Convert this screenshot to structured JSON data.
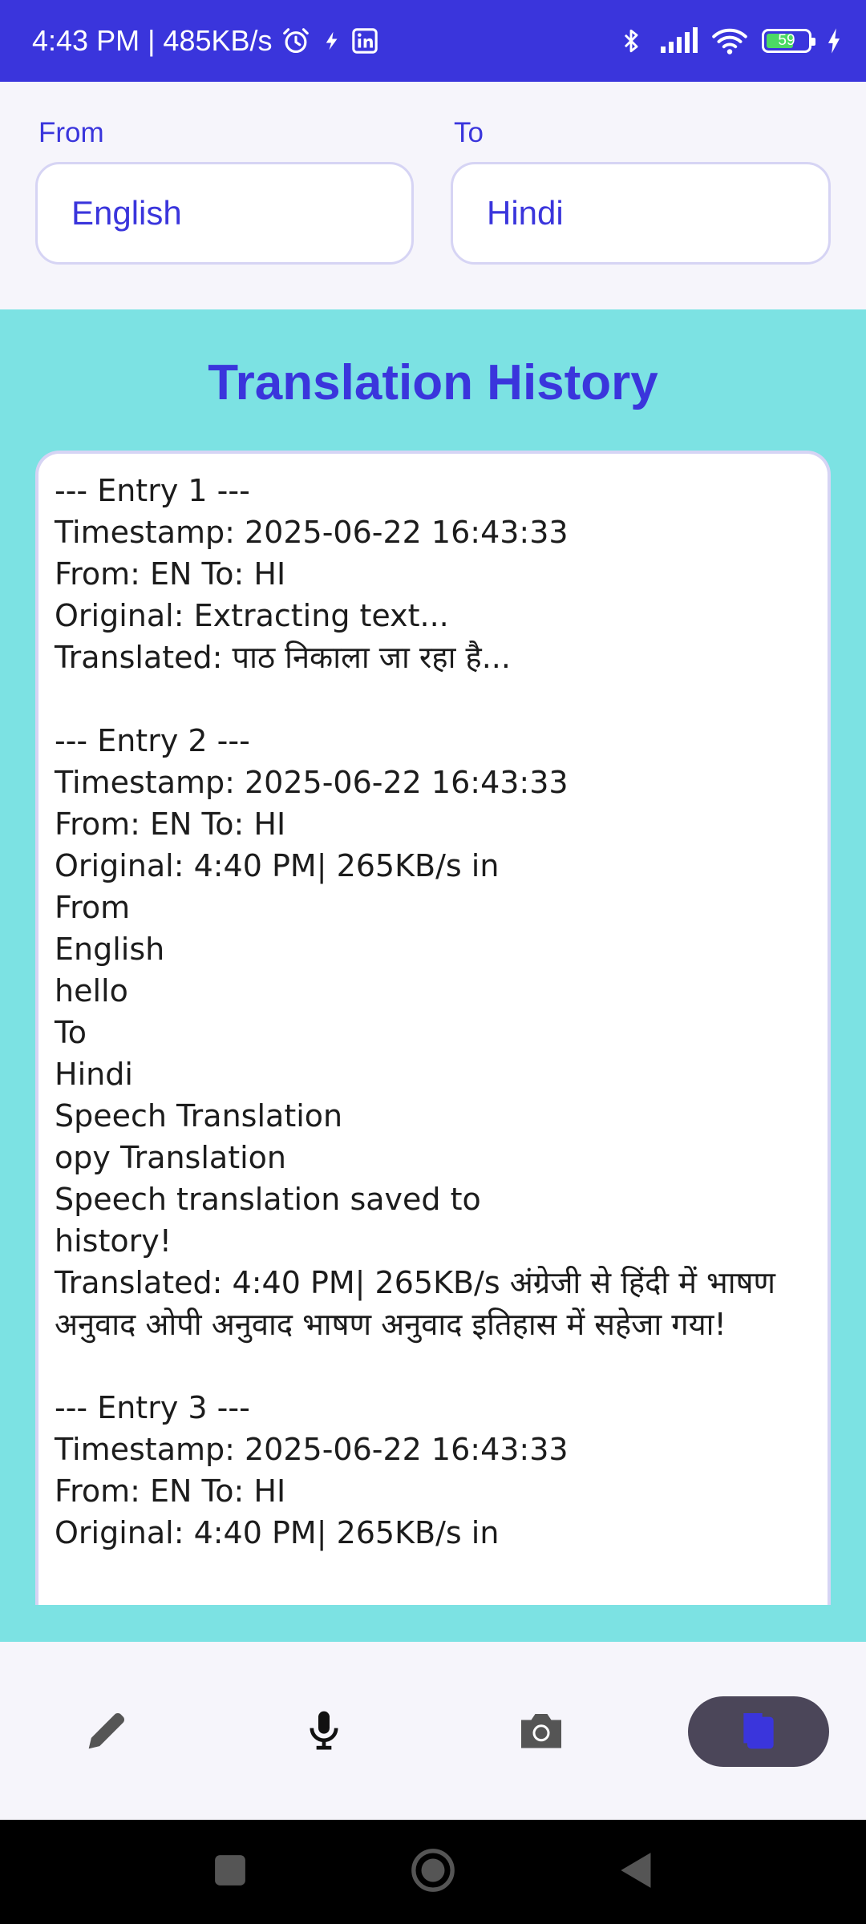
{
  "status_bar": {
    "time_speed": "4:43 PM | 485KB/s",
    "battery_level": "59"
  },
  "language": {
    "from_label": "From",
    "from_value": "English",
    "to_label": "To",
    "to_value": "Hindi"
  },
  "history": {
    "title": "Translation History",
    "content": "--- Entry 1 ---\nTimestamp: 2025-06-22 16:43:33\nFrom: EN To: HI\nOriginal: Extracting text...\nTranslated: पाठ निकाला जा रहा है...\n\n--- Entry 2 ---\nTimestamp: 2025-06-22 16:43:33\nFrom: EN To: HI\nOriginal: 4:40 PM| 265KB/s in\nFrom\nEnglish\nhello\nTo\nHindi\nSpeech Translation\nopy Translation\nSpeech translation saved to\nhistory!\nTranslated: 4:40 PM| 265KB/s अंग्रेजी से हिंदी में भाषण अनुवाद ओपी अनुवाद भाषण अनुवाद इतिहास में सहेजा गया!\n\n--- Entry 3 ---\nTimestamp: 2025-06-22 16:43:33\nFrom: EN To: HI\nOriginal: 4:40 PM| 265KB/s in"
  },
  "bottom_nav": {
    "items": [
      {
        "icon": "pencil-icon",
        "active": false
      },
      {
        "icon": "microphone-icon",
        "active": false
      },
      {
        "icon": "camera-icon",
        "active": false
      },
      {
        "icon": "history-icon",
        "active": true
      }
    ]
  },
  "colors": {
    "primary": "#3a35dc",
    "history_background": "#7ce2e3",
    "nav_active": "#4b4659",
    "icon_inactive": "#555555"
  }
}
